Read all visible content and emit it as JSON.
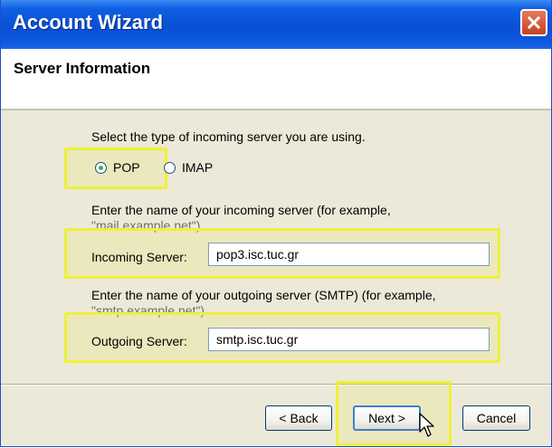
{
  "window": {
    "title": "Account Wizard",
    "close_icon": "close-x-icon",
    "accent_color": "#0a4fd6",
    "close_color": "#c5431f"
  },
  "header": {
    "title": "Server Information"
  },
  "server_type": {
    "prompt": "Select the type of incoming server you are using.",
    "options": [
      {
        "label": "POP",
        "selected": true
      },
      {
        "label": "IMAP",
        "selected": false
      }
    ]
  },
  "incoming": {
    "prompt_line1": "Enter the name of your incoming server (for example,",
    "prompt_line2": "\"mail.example.net\").",
    "label": "Incoming Server:",
    "value": "pop3.isc.tuc.gr"
  },
  "outgoing": {
    "prompt_line1": "Enter the name of your outgoing server (SMTP) (for example,",
    "prompt_line2": "\"smtp.example.net\").",
    "label": "Outgoing Server:",
    "value": "smtp.isc.tuc.gr"
  },
  "buttons": {
    "back": "< Back",
    "next": "Next >",
    "cancel": "Cancel"
  },
  "highlight_color": "#eef03a"
}
